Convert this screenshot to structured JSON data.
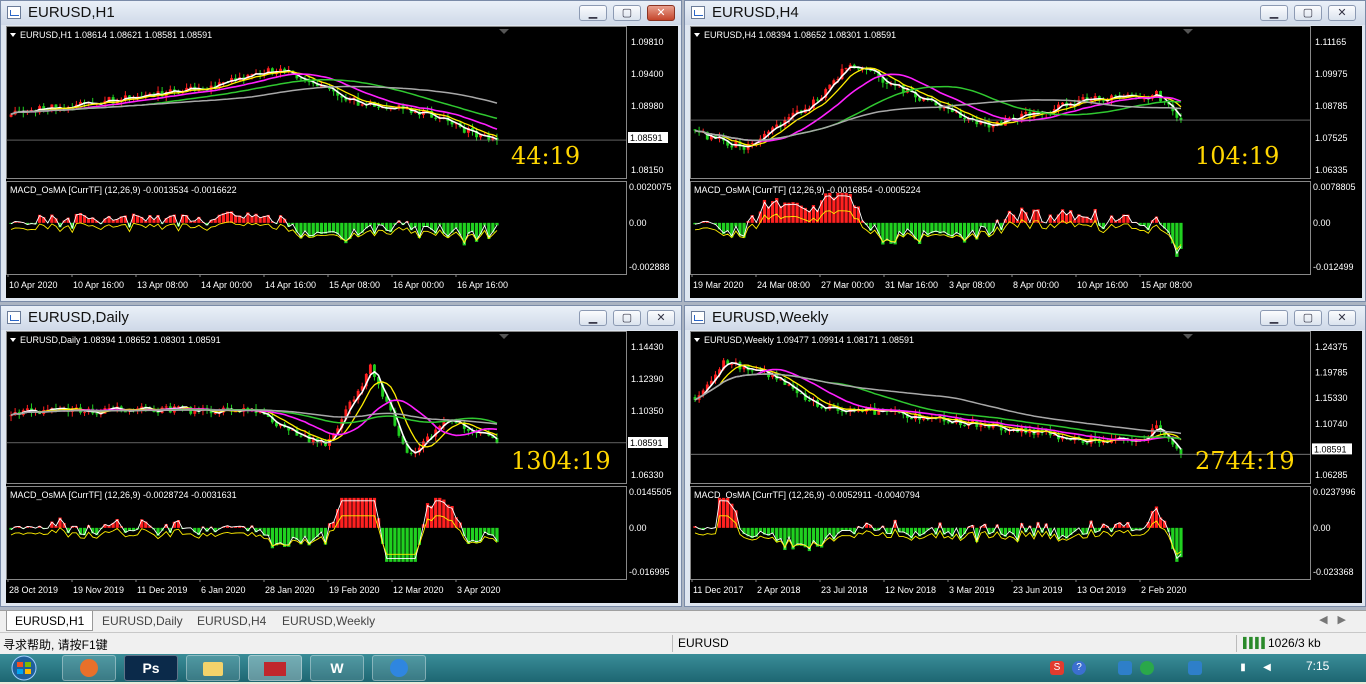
{
  "colors": {
    "bull": "#ff2020",
    "bear": "#20d020",
    "price_line": "#ffffff",
    "ma_yellow": "#ffee00",
    "ma_magenta": "#ff20ff",
    "ma_green": "#30c830",
    "ma_gray": "#a8a8a8",
    "countdown": "#ffd600"
  },
  "icons": {
    "window": "chart-window-icon",
    "minimize": "minimize-icon",
    "maximize": "maximize-icon",
    "close": "close-icon",
    "collapse": "triangle-down-icon"
  },
  "windows": [
    {
      "id": "h1",
      "title": "EURUSD,H1",
      "info": "EURUSD,H1  1.08614 1.08621 1.08581 1.08591",
      "price_axis": [
        "1.09810",
        "1.09400",
        "1.08980",
        "1.08591",
        "1.08150"
      ],
      "current_price": "1.08591",
      "countdown": "44:19",
      "macd_label": "MACD_OsMA [CurrTF] (12,26,9) -0.0013534 -0.0016622",
      "macd_axis": [
        "0.0020075",
        "0.00",
        "-0.002888"
      ],
      "time_labels": [
        "10 Apr 2020",
        "10 Apr 16:00",
        "13 Apr 08:00",
        "14 Apr 00:00",
        "14 Apr 16:00",
        "15 Apr 08:00",
        "16 Apr 00:00",
        "16 Apr 16:00"
      ]
    },
    {
      "id": "h4",
      "title": "EURUSD,H4",
      "info": "EURUSD,H4  1.08394 1.08652 1.08301 1.08591",
      "price_axis": [
        "1.11165",
        "1.09975",
        "1.08785",
        "1.07525",
        "1.06335"
      ],
      "current_price": "1.08591",
      "countdown": "104:19",
      "macd_label": "MACD_OsMA [CurrTF] (12,26,9) -0.0016854 -0.0005224",
      "macd_axis": [
        "0.0078805",
        "0.00",
        "-0.012499"
      ],
      "time_labels": [
        "19 Mar 2020",
        "24 Mar 08:00",
        "27 Mar 00:00",
        "31 Mar 16:00",
        "3 Apr 08:00",
        "8 Apr 00:00",
        "10 Apr 16:00",
        "15 Apr 08:00"
      ]
    },
    {
      "id": "daily",
      "title": "EURUSD,Daily",
      "info": "EURUSD,Daily  1.08394 1.08652 1.08301 1.08591",
      "price_axis": [
        "1.14430",
        "1.12390",
        "1.10350",
        "1.08591",
        "1.06330"
      ],
      "current_price": "1.08591",
      "countdown": "1304:19",
      "macd_label": "MACD_OsMA [CurrTF] (12,26,9) -0.0028724 -0.0031631",
      "macd_axis": [
        "0.0145505",
        "0.00",
        "-0.016995"
      ],
      "time_labels": [
        "28 Oct 2019",
        "19 Nov 2019",
        "11 Dec 2019",
        "6 Jan 2020",
        "28 Jan 2020",
        "19 Feb 2020",
        "12 Mar 2020",
        "3 Apr 2020"
      ]
    },
    {
      "id": "weekly",
      "title": "EURUSD,Weekly",
      "info": "EURUSD,Weekly  1.09477 1.09914 1.08171 1.08591",
      "price_axis": [
        "1.24375",
        "1.19785",
        "1.15330",
        "1.10740",
        "1.08591",
        "1.06285"
      ],
      "current_price": "1.08591",
      "countdown": "2744:19",
      "macd_label": "MACD_OsMA [CurrTF] (12,26,9) -0.0052911 -0.0040794",
      "macd_axis": [
        "0.0237996",
        "0.00",
        "-0.023368"
      ],
      "time_labels": [
        "11 Dec 2017",
        "2 Apr 2018",
        "23 Jul 2018",
        "12 Nov 2018",
        "3 Mar 2019",
        "23 Jun 2019",
        "13 Oct 2019",
        "2 Feb 2020"
      ]
    }
  ],
  "tabs": [
    "EURUSD,H1",
    "EURUSD,Daily",
    "EURUSD,H4",
    "EURUSD,Weekly"
  ],
  "tab_nav": {
    "left": "◀",
    "right": "▶"
  },
  "status": {
    "help": "寻求帮助, 请按F1键",
    "symbol": "EURUSD",
    "traffic": "1026/3 kb"
  },
  "taskbar": {
    "apps": [
      "Ps",
      "W"
    ],
    "time": "7:15"
  }
}
